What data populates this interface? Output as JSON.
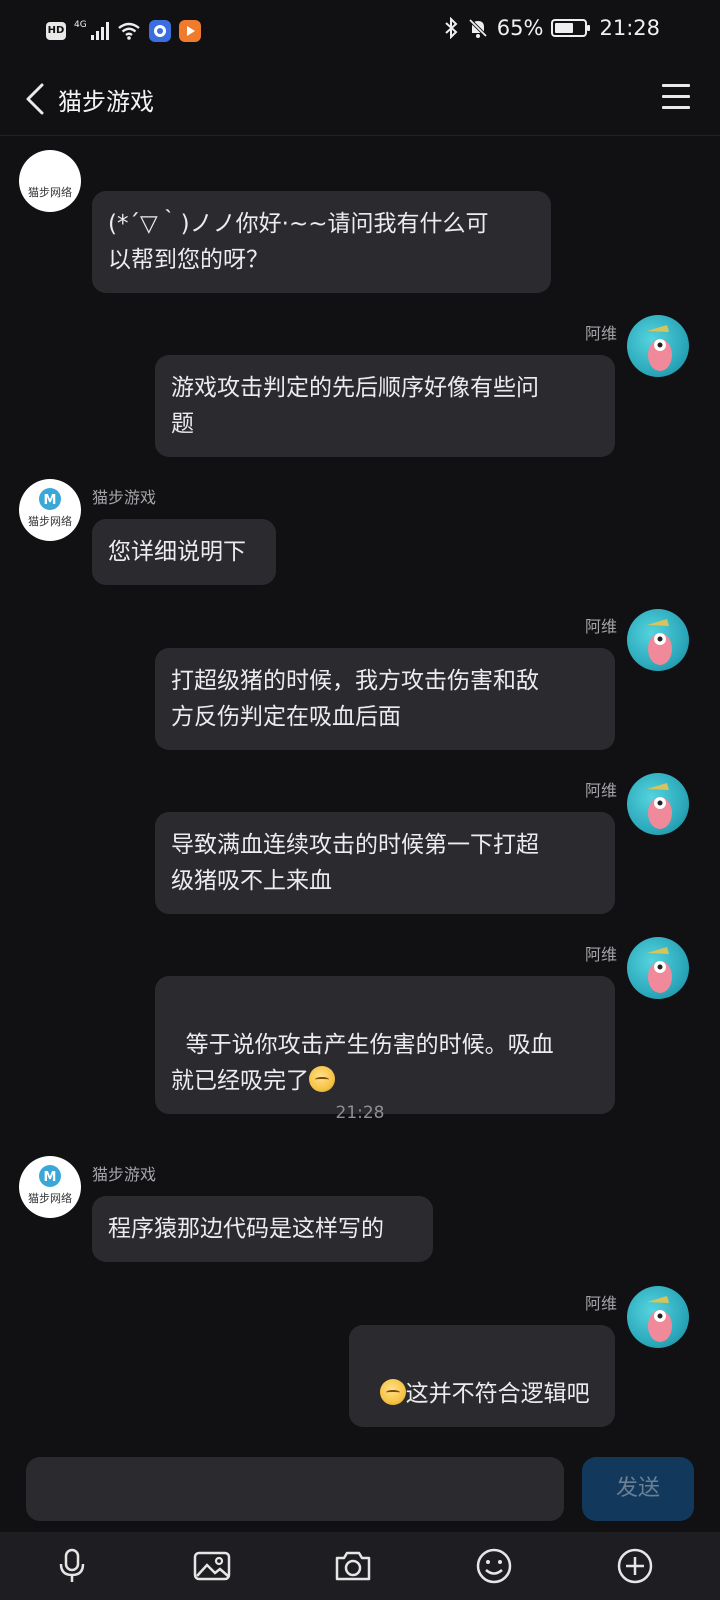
{
  "status_bar": {
    "hd_label": "HD",
    "network": "4G",
    "battery_pct": "65%",
    "battery_level": 0.65,
    "time": "21:28",
    "icons": [
      "wifi-icon",
      "app-icon-blue",
      "app-icon-orange",
      "bluetooth-icon",
      "bell-off-icon",
      "battery-icon"
    ]
  },
  "header": {
    "title": "猫步游戏",
    "back_icon": "back-arrow-icon",
    "menu_icon": "menu-icon"
  },
  "messages": [
    {
      "sender": "",
      "side": "left",
      "text": "(*´▽｀)ノノ你好·~~请问我有什么可\n以帮到您的呀？"
    },
    {
      "sender": "阿维",
      "side": "right",
      "text": "游戏攻击判定的先后顺序好像有些问\n题"
    },
    {
      "sender": "猫步游戏",
      "side": "left",
      "text": "您详细说明下"
    },
    {
      "sender": "阿维",
      "side": "right",
      "text": "打超级猪的时候，我方攻击伤害和敌\n方反伤判定在吸血后面"
    },
    {
      "sender": "阿维",
      "side": "right",
      "text": "导致满血连续攻击的时候第一下打超\n级猪吸不上来血"
    },
    {
      "sender": "阿维",
      "side": "right",
      "text": "等于说你攻击产生伤害的时候。吸血\n就已经吸完了"
    },
    {
      "sender": "猫步游戏",
      "side": "left",
      "text": "程序猿那边代码是这样写的"
    },
    {
      "sender": "阿维",
      "side": "right",
      "text": "这并不符合逻辑吧"
    }
  ],
  "timestamp": "21:28",
  "bot_avatar_text": "猫步网络",
  "composer": {
    "input_value": "",
    "send_label": "发送"
  },
  "toolbar": {
    "icons": [
      "microphone-icon",
      "image-icon",
      "camera-icon",
      "emoji-icon",
      "add-icon"
    ]
  },
  "colors": {
    "background": "#111114",
    "bubble": "#2b2b2f",
    "send_button": "#12395c",
    "toolbar": "#1e1e22"
  }
}
